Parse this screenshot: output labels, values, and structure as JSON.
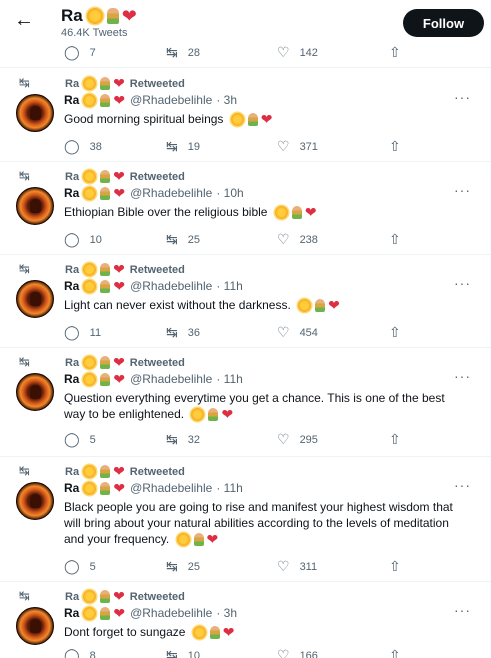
{
  "header": {
    "name": "Ra",
    "tweet_count": "46.4K Tweets",
    "follow_label": "Follow"
  },
  "top_partial": {
    "replies": "7",
    "retweets": "28",
    "likes": "142"
  },
  "retweet_label": "Retweeted",
  "retweeter_name": "Ra",
  "tweets": [
    {
      "name": "Ra",
      "handle": "@Rhadebelihle",
      "time": "· 3h",
      "text": "Good morning spiritual beings",
      "replies": "38",
      "retweets": "19",
      "likes": "371"
    },
    {
      "name": "Ra",
      "handle": "@Rhadebelihle",
      "time": "· 10h",
      "text": "Ethiopian Bible over the religious bible",
      "replies": "10",
      "retweets": "25",
      "likes": "238"
    },
    {
      "name": "Ra",
      "handle": "@Rhadebelihle",
      "time": "· 11h",
      "text": "Light can never exist without the darkness.",
      "replies": "11",
      "retweets": "36",
      "likes": "454"
    },
    {
      "name": "Ra",
      "handle": "@Rhadebelihle",
      "time": "· 11h",
      "text": "Question everything everytime you get a chance. This is one of the best way to be enlightened.",
      "replies": "5",
      "retweets": "32",
      "likes": "295"
    },
    {
      "name": "Ra",
      "handle": "@Rhadebelihle",
      "time": "· 11h",
      "text": "Black people you are going to rise and manifest your highest wisdom that will bring about your natural abilities according to the levels of meditation and your frequency.",
      "replies": "5",
      "retweets": "25",
      "likes": "311"
    },
    {
      "name": "Ra",
      "handle": "@Rhadebelihle",
      "time": "· 3h",
      "text": "Dont forget to sungaze",
      "replies": "8",
      "retweets": "10",
      "likes": "166"
    }
  ],
  "icons": {
    "back": "arrow-left-icon",
    "reply": "reply-icon",
    "retweet": "retweet-icon",
    "like": "heart-icon",
    "share": "share-icon",
    "more": "more-icon"
  },
  "colors": {
    "accent_dark": "#0f1419",
    "secondary_text": "#536471",
    "heart_emoji": "#dd2e44"
  }
}
